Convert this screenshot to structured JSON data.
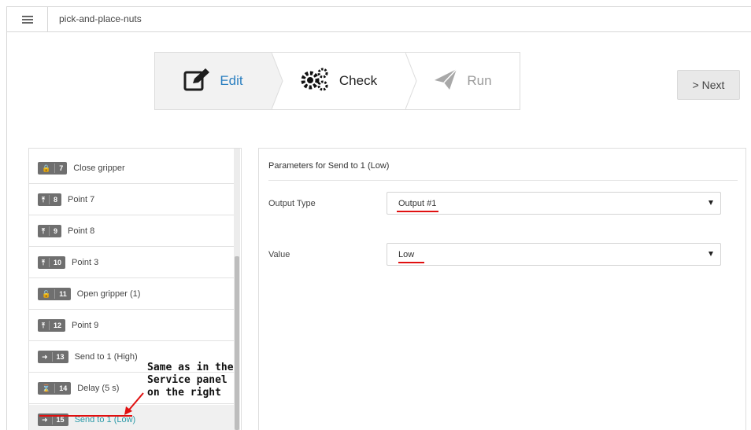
{
  "app": {
    "title": "pick-and-place-nuts"
  },
  "wizard": {
    "steps": [
      {
        "label": "Edit",
        "icon": "edit-icon",
        "state": "active"
      },
      {
        "label": "Check",
        "icon": "gears-icon",
        "state": "enabled"
      },
      {
        "label": "Run",
        "icon": "paper-plane-icon",
        "state": "disabled"
      }
    ],
    "next_label": "> Next"
  },
  "program": {
    "items": [
      {
        "num": "7",
        "icon": "lock-icon",
        "label": "Close gripper"
      },
      {
        "num": "8",
        "icon": "pin-icon",
        "label": "Point 7"
      },
      {
        "num": "9",
        "icon": "pin-icon",
        "label": "Point 8"
      },
      {
        "num": "10",
        "icon": "pin-icon",
        "label": "Point 3"
      },
      {
        "num": "11",
        "icon": "unlock-icon",
        "label": "Open gripper (1)"
      },
      {
        "num": "12",
        "icon": "pin-icon",
        "label": "Point 9"
      },
      {
        "num": "13",
        "icon": "output-icon",
        "label": "Send to 1 (High)"
      },
      {
        "num": "14",
        "icon": "hourglass-icon",
        "label": "Delay (5 s)"
      },
      {
        "num": "15",
        "icon": "output-icon",
        "label": "Send to 1 (Low)",
        "selected": true
      }
    ]
  },
  "params": {
    "header": "Parameters for  Send to 1 (Low)",
    "output_type": {
      "label": "Output Type",
      "value": "Output #1"
    },
    "value": {
      "label": "Value",
      "value": "Low"
    }
  },
  "annotation": {
    "text": "Same as in the\nService panel\non the right",
    "color": "#e01010"
  },
  "colors": {
    "accent": "#2b7fc0",
    "selected_text": "#2b9aa8",
    "badge": "#6f6f6f"
  }
}
